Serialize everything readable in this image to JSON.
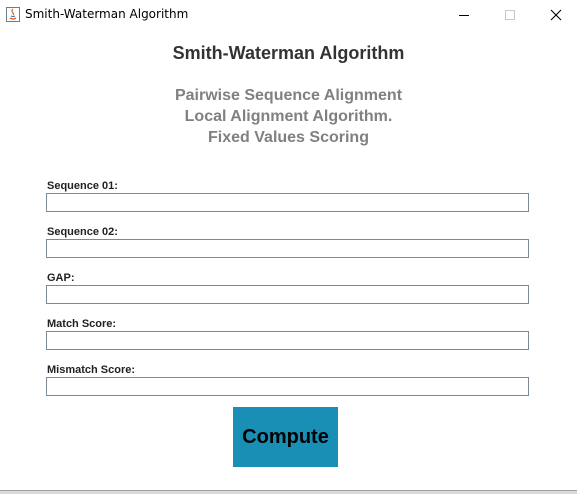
{
  "window": {
    "title": "Smith-Waterman Algorithm",
    "icon": "java-icon"
  },
  "header": {
    "title": "Smith-Waterman Algorithm",
    "subtitle_lines": [
      "Pairwise Sequence Alignment",
      "Local Alignment Algorithm.",
      "Fixed Values Scoring"
    ]
  },
  "form": {
    "fields": [
      {
        "label": "Sequence 01:",
        "value": ""
      },
      {
        "label": "Sequence 02:",
        "value": ""
      },
      {
        "label": "GAP:",
        "value": ""
      },
      {
        "label": "Match Score:",
        "value": ""
      },
      {
        "label": "Mismatch Score:",
        "value": ""
      }
    ],
    "compute_label": "Compute"
  },
  "colors": {
    "button": "#1a8fb5",
    "heading": "#333333",
    "subheading": "#808080",
    "input_border": "#7a8a99"
  }
}
